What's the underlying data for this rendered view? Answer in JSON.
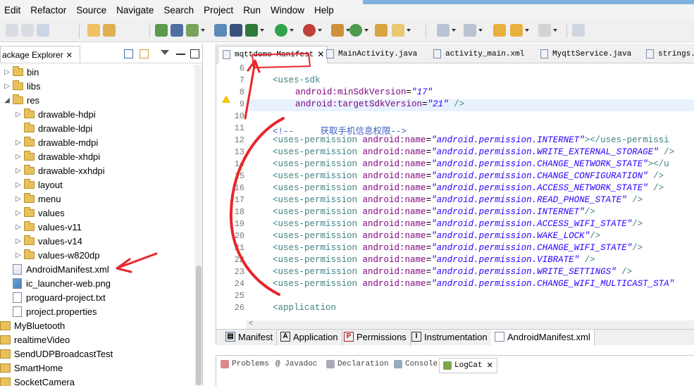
{
  "menu": [
    "Edit",
    "Refactor",
    "Source",
    "Navigate",
    "Search",
    "Project",
    "Run",
    "Window",
    "Help"
  ],
  "explorer": {
    "title": "ackage Explorer",
    "close": "✕",
    "items": [
      {
        "label": "bin",
        "twisty": "▷"
      },
      {
        "label": "libs",
        "twisty": "▷"
      },
      {
        "label": "res",
        "twisty": "◢"
      },
      {
        "label": "drawable-hdpi",
        "twisty": "▷"
      },
      {
        "label": "drawable-ldpi",
        "twisty": ""
      },
      {
        "label": "drawable-mdpi",
        "twisty": "▷"
      },
      {
        "label": "drawable-xhdpi",
        "twisty": "▷"
      },
      {
        "label": "drawable-xxhdpi",
        "twisty": "▷"
      },
      {
        "label": "layout",
        "twisty": "▷"
      },
      {
        "label": "menu",
        "twisty": "▷"
      },
      {
        "label": "values",
        "twisty": "▷"
      },
      {
        "label": "values-v11",
        "twisty": "▷"
      },
      {
        "label": "values-v14",
        "twisty": "▷"
      },
      {
        "label": "values-w820dp",
        "twisty": "▷"
      },
      {
        "label": "AndroidManifest.xml"
      },
      {
        "label": "ic_launcher-web.png"
      },
      {
        "label": "proguard-project.txt"
      },
      {
        "label": "project.properties"
      },
      {
        "label": "MyBluetooth"
      },
      {
        "label": "realtimeVideo"
      },
      {
        "label": "SendUDPBroadcastTest"
      },
      {
        "label": "SmartHome"
      },
      {
        "label": "SocketCamera"
      }
    ]
  },
  "editor_tabs": [
    {
      "label": "mqttdemo Manifest",
      "close": "✕"
    },
    {
      "label": "MainActivity.java"
    },
    {
      "label": "activity_main.xml"
    },
    {
      "label": "MyqttService.java"
    },
    {
      "label": "strings.x"
    }
  ],
  "line_numbers": [
    "6",
    "7",
    "8",
    "9",
    "10",
    "11",
    "12",
    "13",
    "14",
    "15",
    "16",
    "17",
    "18",
    "19",
    "20",
    "21",
    "22",
    "23",
    "24",
    "25",
    "26"
  ],
  "code": {
    "l7": {
      "tag": "<uses-sdk"
    },
    "l8": {
      "attr": "android:minSdkVersion",
      "eq": "=",
      "val": "\"17\""
    },
    "l9": {
      "attr": "android:targetSdkVersion",
      "eq": "=",
      "val": "\"21\"",
      "end": " />"
    },
    "l11": "<!--     获取手机信息权限-->",
    "tag_open": "<uses-permission",
    "attr_name": "android:name",
    "eq": "=",
    "permissions": [
      {
        "val": "\"android.permission.INTERNET\"",
        "end": "></uses-permissi"
      },
      {
        "val": "\"android.permission.WRITE_EXTERNAL_STORAGE\"",
        "end": " />"
      },
      {
        "val": "\"android.permission.CHANGE_NETWORK_STATE\"",
        "end": "></u"
      },
      {
        "val": "\"android.permission.CHANGE_CONFIGURATION\"",
        "end": " />"
      },
      {
        "val": "\"android.permission.ACCESS_NETWORK_STATE\"",
        "end": " />"
      },
      {
        "val": "\"android.permission.READ_PHONE_STATE\"",
        "end": " />"
      },
      {
        "val": "\"android.permission.INTERNET\"",
        "end": "/>"
      },
      {
        "val": "\"android.permission.ACCESS_WIFI_STATE\"",
        "end": "/>"
      },
      {
        "val": "\"android.permission.WAKE_LOCK\"",
        "end": "/>"
      },
      {
        "val": "\"android.permission.CHANGE_WIFI_STATE\"",
        "end": "/>"
      },
      {
        "val": "\"android.permission.VIBRATE\"",
        "end": " />"
      },
      {
        "val": "\"android.permission.WRITE_SETTINGS\"",
        "end": " />"
      },
      {
        "val": "\"android.permission.CHANGE_WIFI_MULTICAST_STA\"",
        "end": ""
      }
    ],
    "l26": "<application"
  },
  "bottom_tabs": [
    {
      "label": "Manifest",
      "icon": "▤"
    },
    {
      "label": "Application",
      "icon": "A"
    },
    {
      "label": "Permissions",
      "icon": "P"
    },
    {
      "label": "Instrumentation",
      "icon": "I"
    },
    {
      "label": "AndroidManifest.xml",
      "icon": ""
    }
  ],
  "views": [
    {
      "label": "Problems"
    },
    {
      "label": "@ Javadoc"
    },
    {
      "label": "Declaration"
    },
    {
      "label": "Console"
    },
    {
      "label": "LogCat",
      "close": "✕"
    }
  ],
  "colors": {
    "annotation_red": "#e8262c",
    "tag": "#3f7f7f",
    "attr": "#7f007f",
    "value": "#2a00ff",
    "comment": "#3f5fbf"
  }
}
